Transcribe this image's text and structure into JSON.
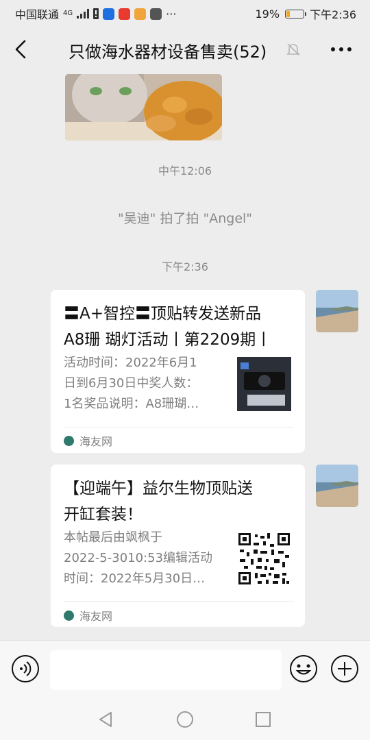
{
  "status": {
    "carrier": "中国联通",
    "network": "4G",
    "battery_percent": "19%",
    "time": "下午2:36"
  },
  "header": {
    "title": "只做海水器材设备售卖(52)"
  },
  "chat": {
    "timestamp_1": "中午12:06",
    "system_message": "\"吴迪\" 拍了拍 \"Angel\"",
    "timestamp_2": "下午2:36",
    "messages": [
      {
        "title": "〓A+智控〓顶贴转发送新品A8珊 瑚灯活动丨第2209期丨",
        "title_line1": "〓A+智控〓顶贴转发送新品",
        "title_line2": "A8珊 瑚灯活动丨第2209期丨",
        "desc_line1": "活动时间：2022年6月1",
        "desc_line2": "日到6月30日中奖人数：",
        "desc_line3": "1名奖品说明：A8珊瑚…",
        "source": "海友网"
      },
      {
        "title_line1": "【迎端午】益尔生物顶贴送",
        "title_line2": "开缸套装！",
        "desc_line1": "本帖最后由飒枫于",
        "desc_line2": "2022-5-3010:53编辑活动",
        "desc_line3": "时间：2022年5月30日…",
        "source": "海友网"
      }
    ]
  },
  "icons": {
    "back": "chevron-left-icon",
    "mute": "bell-off-icon",
    "more": "more-dots-icon",
    "voice": "voice-icon",
    "emoji": "emoji-icon",
    "plus": "plus-icon"
  },
  "colors": {
    "background": "#ededed",
    "card": "#ffffff",
    "muted_text": "#8a8a8a",
    "battery": "#f5a623"
  },
  "battery_level": 0.19
}
